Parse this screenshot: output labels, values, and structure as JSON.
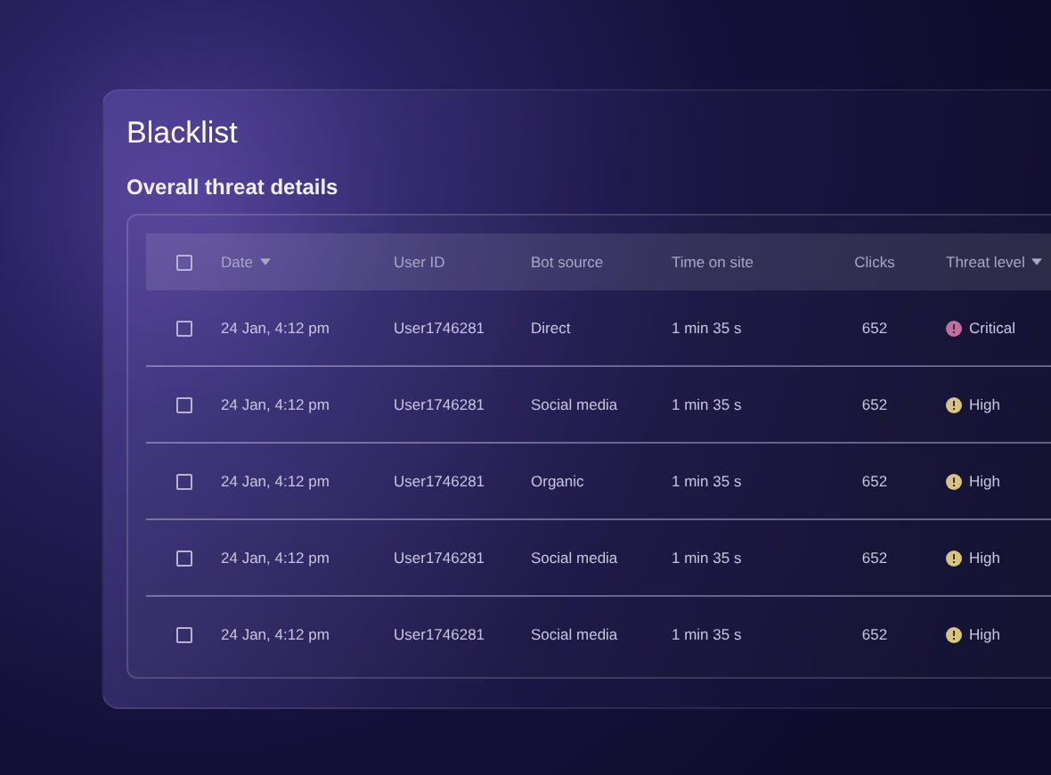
{
  "page": {
    "title": "Blacklist",
    "subtitle": "Overall threat details"
  },
  "table": {
    "select_all": {
      "checked": false
    },
    "columns": [
      {
        "label": "Date",
        "sortable": true
      },
      {
        "label": "User ID",
        "sortable": false
      },
      {
        "label": "Bot source",
        "sortable": false
      },
      {
        "label": "Time on site",
        "sortable": false
      },
      {
        "label": "Clicks",
        "sortable": false
      },
      {
        "label": "Threat level",
        "sortable": true
      }
    ],
    "rows": [
      {
        "checked": false,
        "date": "24 Jan, 4:12 pm",
        "user_id": "User1746281",
        "bot_source": "Direct",
        "time_on_site": "1 min 35 s",
        "clicks": "652",
        "threat": {
          "label": "Critical",
          "color": "#c0709a"
        }
      },
      {
        "checked": false,
        "date": "24 Jan, 4:12 pm",
        "user_id": "User1746281",
        "bot_source": "Social media",
        "time_on_site": "1 min 35 s",
        "clicks": "652",
        "threat": {
          "label": "High",
          "color": "#d8c47e"
        }
      },
      {
        "checked": false,
        "date": "24 Jan, 4:12 pm",
        "user_id": "User1746281",
        "bot_source": "Organic",
        "time_on_site": "1 min 35 s",
        "clicks": "652",
        "threat": {
          "label": "High",
          "color": "#d8c47e"
        }
      },
      {
        "checked": false,
        "date": "24 Jan, 4:12 pm",
        "user_id": "User1746281",
        "bot_source": "Social media",
        "time_on_site": "1 min 35 s",
        "clicks": "652",
        "threat": {
          "label": "High",
          "color": "#d8c47e"
        }
      },
      {
        "checked": false,
        "date": "24 Jan, 4:12 pm",
        "user_id": "User1746281",
        "bot_source": "Social media",
        "time_on_site": "1 min 35 s",
        "clicks": "652",
        "threat": {
          "label": "High",
          "color": "#d8c47e"
        }
      }
    ]
  }
}
